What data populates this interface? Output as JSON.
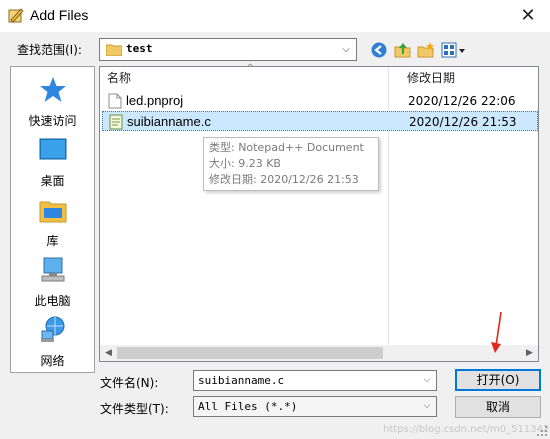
{
  "window": {
    "title": "Add Files",
    "close_glyph": "✕"
  },
  "lookin": {
    "label": "查找范围(I):",
    "value": "test"
  },
  "toolbar": {
    "icons": [
      "back-icon",
      "up-folder-icon",
      "new-folder-icon",
      "view-menu-icon"
    ]
  },
  "places": [
    {
      "label": "快速访问",
      "icon": "quick-access-star-icon"
    },
    {
      "label": "桌面",
      "icon": "desktop-icon"
    },
    {
      "label": "库",
      "icon": "library-icon"
    },
    {
      "label": "此电脑",
      "icon": "this-pc-icon"
    },
    {
      "label": "网络",
      "icon": "network-icon"
    }
  ],
  "filelist": {
    "columns": [
      "名称",
      "修改日期"
    ],
    "rows": [
      {
        "name": "led.pnproj",
        "modified": "2020/12/26 22:06",
        "icon": "document-icon",
        "selected": false
      },
      {
        "name": "suibianname.c",
        "modified": "2020/12/26 21:53",
        "icon": "notepadpp-file-icon",
        "selected": true
      }
    ]
  },
  "tooltip": {
    "type_line": "类型: Notepad++ Document",
    "size_line": "大小: 9.23 KB",
    "date_line": "修改日期: 2020/12/26 21:53"
  },
  "filename": {
    "label": "文件名(N):",
    "value": "suibianname.c"
  },
  "filetype": {
    "label": "文件类型(T):",
    "value": "All Files (*.*)"
  },
  "buttons": {
    "open": "打开(O)",
    "cancel": "取消"
  },
  "watermark": "https://blog.csdn.net/m0_51134230",
  "colors": {
    "selection": "#cce8ff",
    "default_button_border": "#0078d7",
    "annotation_arrow": "#e0281f"
  }
}
